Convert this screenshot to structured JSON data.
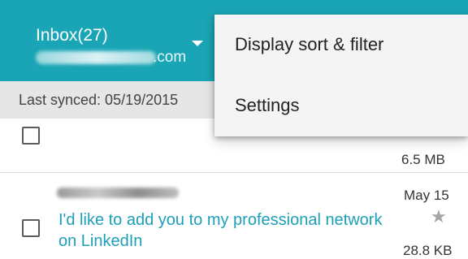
{
  "header": {
    "inbox_label": "Inbox(27)",
    "account_suffix": ".com"
  },
  "sync": {
    "label": "Last synced: 05/19/2015"
  },
  "messages": [
    {
      "size": "6.5 MB"
    },
    {
      "date": "May 15",
      "subject": "I'd like to add you to my professional network on LinkedIn",
      "starred": false,
      "size": "28.8 KB"
    }
  ],
  "menu": {
    "items": [
      {
        "label": "Display sort & filter"
      },
      {
        "label": "Settings"
      }
    ]
  },
  "colors": {
    "appbar": "#19a5b5",
    "subject_link": "#1c9fb8",
    "sync_bar": "#e6e6e6",
    "menu_bg": "#f4f4f4"
  }
}
